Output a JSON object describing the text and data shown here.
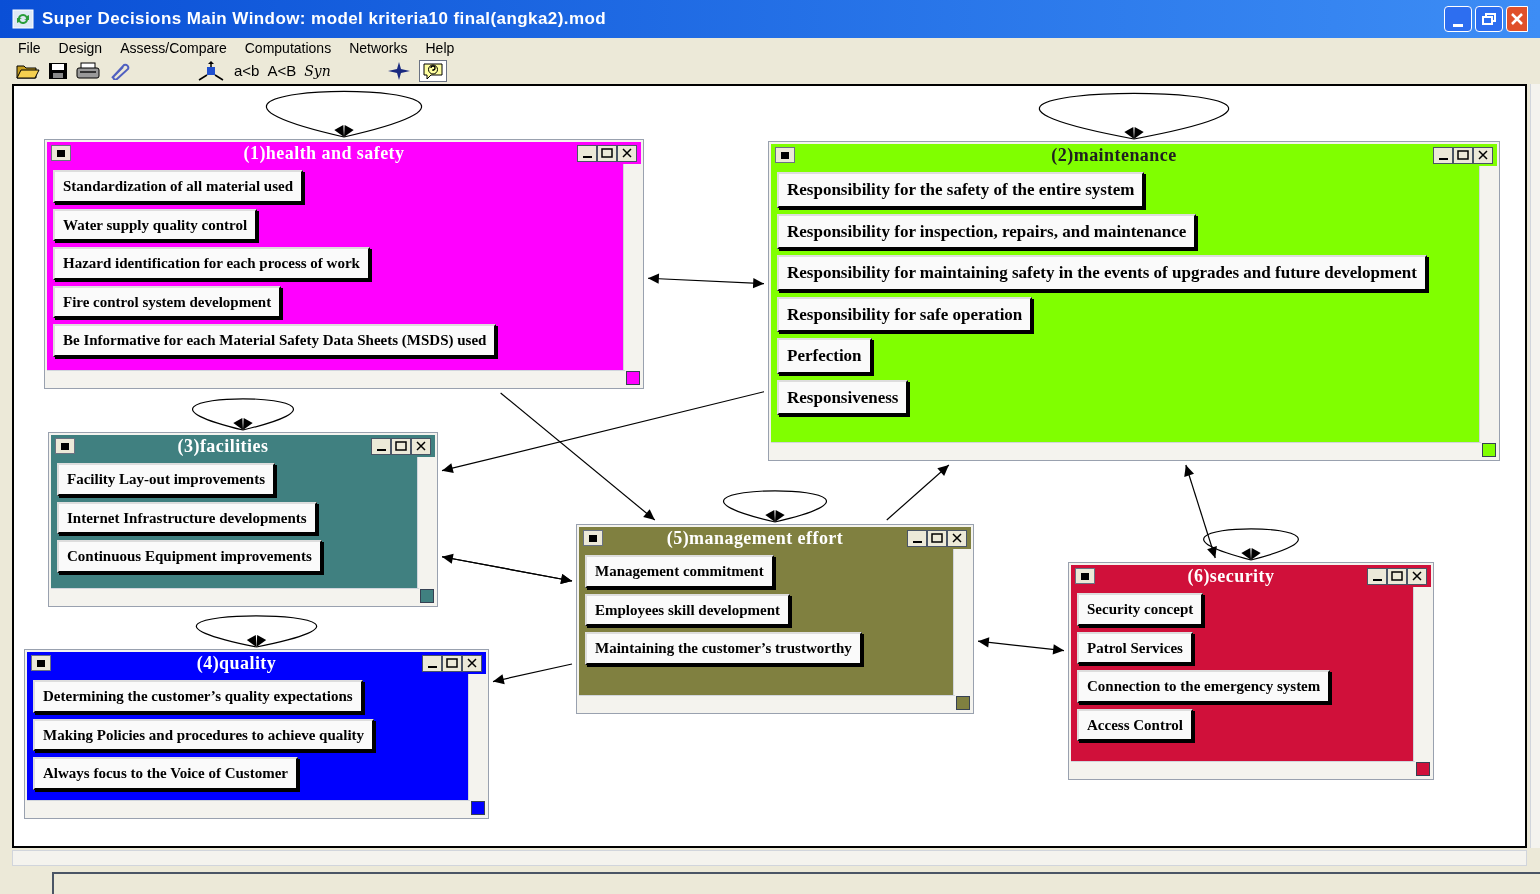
{
  "window": {
    "title": "Super Decisions Main Window: model kriteria10 final(angka2).mod"
  },
  "menu": [
    "File",
    "Design",
    "Assess/Compare",
    "Computations",
    "Networks",
    "Help"
  ],
  "toolbar": {
    "text_tools": [
      "a<b",
      "A<B",
      "Syn"
    ]
  },
  "clusters": [
    {
      "title": "(1)health and safety",
      "color": "#ff00ff",
      "nodes": [
        "Standardization of all material used",
        "Water supply quality control",
        "Hazard identification for each process of work",
        "Fire control system  development",
        "Be Informative for each Material Safety Data Sheets (MSDS) used"
      ]
    },
    {
      "title": "(2)maintenance",
      "color": "#80ff00",
      "nodes": [
        "Responsibility for the safety of the entire system",
        "Responsibility for inspection, repairs, and maintenance",
        "Responsibility for maintaining safety in the events of upgrades and future development",
        "Responsibility for safe operation",
        "Perfection",
        "Responsiveness"
      ]
    },
    {
      "title": "(3)facilities",
      "color": "#408080",
      "nodes": [
        "Facility Lay-out improvements",
        "Internet Infrastructure developments",
        "Continuous Equipment improvements"
      ]
    },
    {
      "title": "(4)quality",
      "color": "#0000ff",
      "nodes": [
        "Determining the customer’s quality expectations",
        "Making Policies and procedures to achieve quality",
        "Always focus to the Voice of Customer"
      ]
    },
    {
      "title": "(5)management effort",
      "color": "#808040",
      "nodes": [
        "Management commitment",
        "Employees skill development",
        "Maintaining the customer’s trustworthy"
      ]
    },
    {
      "title": "(6)security",
      "color": "#d0103a",
      "nodes": [
        "Security concept",
        "Patrol Services",
        "Connection to the emergency system",
        "Access Control"
      ]
    }
  ]
}
